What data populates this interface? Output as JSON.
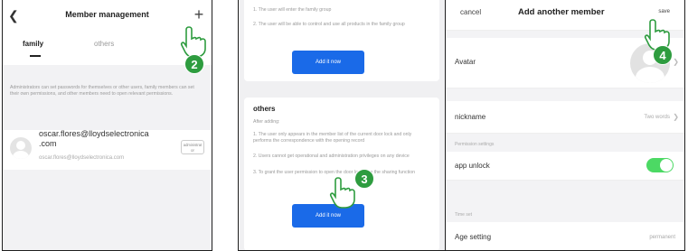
{
  "colors": {
    "accent": "#1a6ae8",
    "step_badge": "#2e9c3f",
    "toggle_on": "#4cd964"
  },
  "panel1": {
    "title": "Member management",
    "tabs": [
      "family",
      "others"
    ],
    "note": "Administrators can set passwords for themselves or other users, family members can set their own permissions, and other members need to open relevant permissions.",
    "member": {
      "name": "oscar.flores@lloydselectronica\n.com",
      "sub": "oscar.flores@lloydselectronica.com",
      "badge": "administrat or"
    }
  },
  "panel2": {
    "family_texts": [
      "1. The user will enter the family group",
      "2. The user will be able to control and use all products in the family group"
    ],
    "add_button": "Add it now",
    "others_title": "others",
    "others_sub": "After adding:",
    "others_texts": [
      "1. The user only appears in the member list of the current door lock and only performs the correspondence with the opening record",
      "2. Users cannot get operational and administration privileges on any device",
      "3. To grant the user permission to open the door lock, use the sharing function"
    ],
    "add_button_2": "Add it now"
  },
  "panel3": {
    "cancel": "cancel",
    "title": "Add another member",
    "save": "save",
    "avatar_label": "Avatar",
    "nickname_label": "nickname",
    "nickname_value": "Two words",
    "permission_header": "Permission settings",
    "app_unlock_label": "app unlock",
    "app_unlock_on": true,
    "time_header": "Time set",
    "age_label": "Age setting",
    "age_value": "permanent"
  },
  "steps": [
    "2",
    "3",
    "4"
  ]
}
